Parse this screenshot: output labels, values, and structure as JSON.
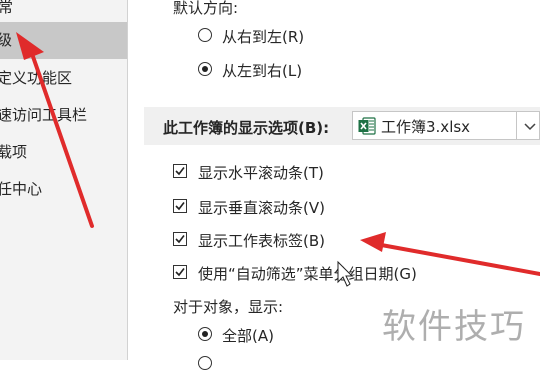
{
  "sidebar": {
    "items": [
      {
        "label": "常"
      },
      {
        "label": "级"
      },
      {
        "label": "定义功能区"
      },
      {
        "label": "速访问工具栏"
      },
      {
        "label": "载项"
      },
      {
        "label": "任中心"
      }
    ]
  },
  "direction": {
    "heading": "默认方向:",
    "options": [
      {
        "label": "从右到左(R)",
        "checked": false
      },
      {
        "label": "从左到右(L)",
        "checked": true
      }
    ]
  },
  "workbook_section": {
    "title": "此工作簿的显示选项(B):",
    "selected_workbook": "工作簿3.xlsx",
    "icon": "excel-icon"
  },
  "options": [
    {
      "label": "显示水平滚动条(T)",
      "checked": true
    },
    {
      "label": "显示垂直滚动条(V)",
      "checked": true
    },
    {
      "label": "显示工作表标签(B)",
      "checked": true
    },
    {
      "label": "使用“自动筛选”菜单分组日期(G)",
      "checked": true
    }
  ],
  "objects": {
    "heading": "对于对象，显示:",
    "options": [
      {
        "label": "全部(A)",
        "checked": true
      }
    ]
  },
  "watermark": "软件技巧",
  "colors": {
    "annotation_arrow": "#e02b2b",
    "selected_nav": "#c8c8c8",
    "excel_green": "#1e7145"
  }
}
